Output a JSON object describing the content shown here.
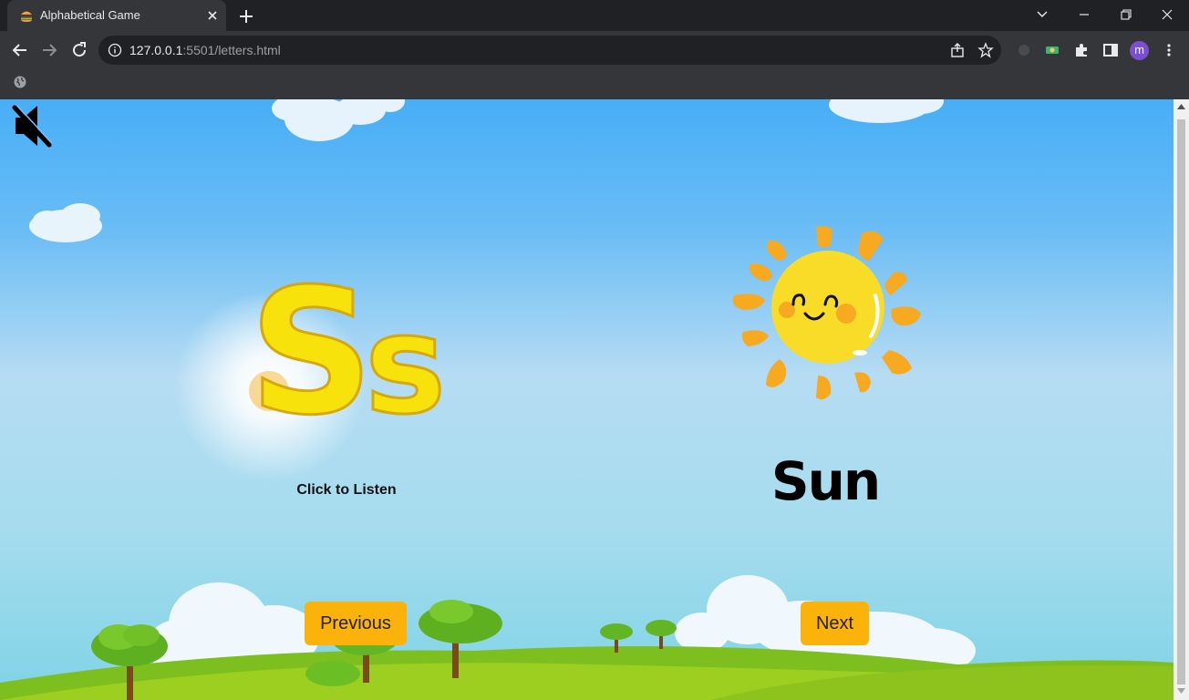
{
  "browser": {
    "tab_title": "Alphabetical Game",
    "url_host": "127.0.0.1",
    "url_rest": ":5501/letters.html",
    "profile_initial": "m"
  },
  "page": {
    "letter_upper": "S",
    "letter_lower": "s",
    "listen_label": "Click to Listen",
    "word": "Sun",
    "prev_label": "Previous",
    "next_label": "Next"
  },
  "colors": {
    "button": "#fbb30b",
    "letter_fill": "#f7e20c",
    "sun_face": "#f9dc27",
    "sun_rays": "#f7a91f"
  },
  "icons": {
    "mute": "speaker-muted-icon",
    "sun": "sun-illustration"
  }
}
